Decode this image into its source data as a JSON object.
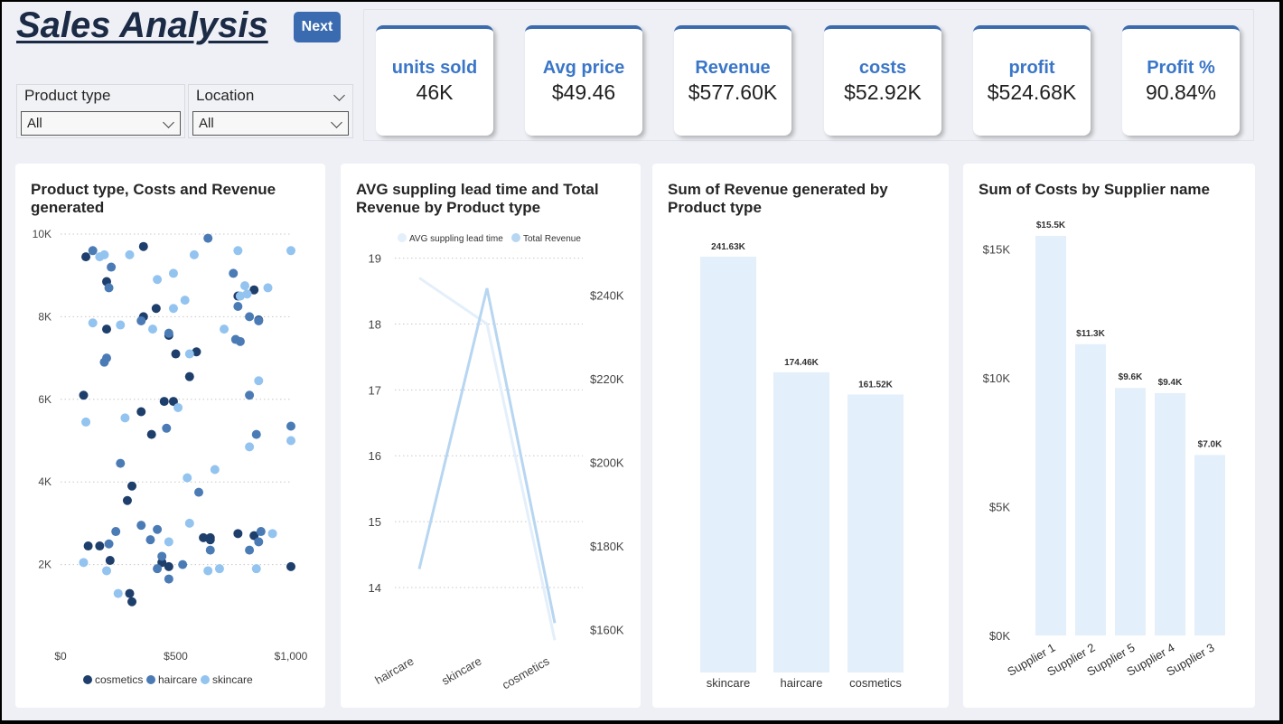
{
  "header": {
    "title": "Sales Analysis",
    "next_label": "Next"
  },
  "filters": [
    {
      "label": "Product type",
      "value": "All"
    },
    {
      "label": "Location",
      "value": "All"
    }
  ],
  "kpis": [
    {
      "label": "units sold",
      "value": "46K"
    },
    {
      "label": "Avg price",
      "value": "$49.46"
    },
    {
      "label": "Revenue",
      "value": "$577.60K"
    },
    {
      "label": "costs",
      "value": "$52.92K"
    },
    {
      "label": "profit",
      "value": "$524.68K"
    },
    {
      "label": "Profit %",
      "value": "90.84%"
    }
  ],
  "chart_data": [
    {
      "type": "scatter",
      "title": "Product type, Costs and Revenue generated",
      "xlim": [
        0,
        1000
      ],
      "ylim": [
        0,
        10000
      ],
      "x_ticks": [
        "$0",
        "$500",
        "$1,000"
      ],
      "y_ticks": [
        "2K",
        "4K",
        "6K",
        "8K",
        "10K"
      ],
      "legend_position": "bottom",
      "colors": {
        "cosmetics": "#1e3f6b",
        "haircare": "#4b7bb5",
        "skincare": "#93c3ef"
      },
      "series": [
        {
          "name": "cosmetics",
          "points": [
            [
              110,
              9450
            ],
            [
              360,
              9700
            ],
            [
              200,
              8850
            ],
            [
              360,
              8000
            ],
            [
              415,
              8200
            ],
            [
              200,
              7700
            ],
            [
              470,
              7550
            ],
            [
              500,
              7100
            ],
            [
              590,
              7150
            ],
            [
              560,
              6550
            ],
            [
              450,
              5950
            ],
            [
              490,
              5950
            ],
            [
              100,
              6100
            ],
            [
              395,
              5150
            ],
            [
              350,
              5700
            ],
            [
              310,
              3900
            ],
            [
              770,
              8500
            ],
            [
              840,
              8650
            ],
            [
              860,
              7920
            ],
            [
              120,
              2450
            ],
            [
              170,
              2450
            ],
            [
              215,
              2100
            ],
            [
              620,
              2650
            ],
            [
              650,
              2650
            ],
            [
              650,
              2600
            ],
            [
              770,
              2750
            ],
            [
              840,
              2700
            ],
            [
              1000,
              1950
            ],
            [
              300,
              1300
            ],
            [
              310,
              1100
            ],
            [
              440,
              2050
            ],
            [
              470,
              1950
            ],
            [
              290,
              3550
            ]
          ]
        },
        {
          "name": "haircare",
          "points": [
            [
              140,
              9600
            ],
            [
              210,
              8700
            ],
            [
              220,
              9200
            ],
            [
              190,
              6900
            ],
            [
              200,
              7000
            ],
            [
              350,
              7900
            ],
            [
              470,
              7600
            ],
            [
              460,
              5300
            ],
            [
              640,
              9900
            ],
            [
              750,
              9050
            ],
            [
              760,
              7450
            ],
            [
              780,
              7400
            ],
            [
              770,
              8250
            ],
            [
              820,
              8000
            ],
            [
              860,
              7900
            ],
            [
              820,
              6100
            ],
            [
              850,
              5150
            ],
            [
              1000,
              5350
            ],
            [
              350,
              2950
            ],
            [
              420,
              2850
            ],
            [
              390,
              2600
            ],
            [
              260,
              4450
            ],
            [
              420,
              1900
            ],
            [
              470,
              1650
            ],
            [
              440,
              2200
            ],
            [
              530,
              2000
            ],
            [
              600,
              3750
            ],
            [
              650,
              2350
            ],
            [
              820,
              2350
            ],
            [
              860,
              2550
            ],
            [
              870,
              2800
            ],
            [
              210,
              2500
            ],
            [
              240,
              2800
            ]
          ]
        },
        {
          "name": "skincare",
          "points": [
            [
              170,
              9450
            ],
            [
              190,
              9500
            ],
            [
              300,
              9500
            ],
            [
              420,
              8900
            ],
            [
              490,
              9050
            ],
            [
              580,
              9500
            ],
            [
              770,
              9600
            ],
            [
              780,
              8500
            ],
            [
              800,
              8750
            ],
            [
              810,
              8550
            ],
            [
              900,
              8700
            ],
            [
              1000,
              9600
            ],
            [
              490,
              8200
            ],
            [
              540,
              8400
            ],
            [
              400,
              7700
            ],
            [
              140,
              7850
            ],
            [
              260,
              7800
            ],
            [
              510,
              5800
            ],
            [
              110,
              5450
            ],
            [
              280,
              5550
            ],
            [
              560,
              7100
            ],
            [
              710,
              7700
            ],
            [
              860,
              6450
            ],
            [
              820,
              4850
            ],
            [
              1000,
              5000
            ],
            [
              550,
              4100
            ],
            [
              670,
              4300
            ],
            [
              100,
              2050
            ],
            [
              200,
              1850
            ],
            [
              560,
              3000
            ],
            [
              690,
              1900
            ],
            [
              640,
              1850
            ],
            [
              850,
              1900
            ],
            [
              920,
              2750
            ],
            [
              470,
              2550
            ],
            [
              250,
              1300
            ]
          ]
        }
      ]
    },
    {
      "type": "line",
      "title": "AVG suppling lead time and Total Revenue by Product type",
      "categories": [
        "haircare",
        "skincare",
        "cosmetics"
      ],
      "legend_position": "top",
      "y_left_ticks": [
        "14",
        "15",
        "16",
        "17",
        "18",
        "19"
      ],
      "y_left_lim": [
        13.3,
        19.2
      ],
      "y_right_ticks": [
        "$160K",
        "$180K",
        "$200K",
        "$220K",
        "$240K"
      ],
      "y_right_lim": [
        159000,
        252000
      ],
      "series": [
        {
          "name": "AVG suppling lead time",
          "axis": "left",
          "values": [
            18.7,
            18.0,
            13.2
          ]
        },
        {
          "name": "Total Revenue",
          "axis": "right",
          "values": [
            174460,
            241630,
            161520
          ]
        }
      ],
      "colors": {
        "AVG suppling lead time": "#e3effa",
        "Total Revenue": "#b7d6f1"
      }
    },
    {
      "type": "bar",
      "title": "Sum of Revenue generated by Product type",
      "categories": [
        "skincare",
        "haircare",
        "cosmetics"
      ],
      "values": [
        241.63,
        174.46,
        161.52
      ],
      "labels": [
        "241.63K",
        "174.46K",
        "161.52K"
      ],
      "ylim": [
        0,
        241.63
      ],
      "color": "#e3effb"
    },
    {
      "type": "bar",
      "title": "Sum of Costs by Supplier name",
      "categories": [
        "Supplier 1",
        "Supplier 2",
        "Supplier 5",
        "Supplier 4",
        "Supplier 3"
      ],
      "values": [
        15.5,
        11.3,
        9.6,
        9.4,
        7.0
      ],
      "labels": [
        "$15.5K",
        "$11.3K",
        "$9.6K",
        "$9.4K",
        "$7.0K"
      ],
      "y_ticks": [
        "$0K",
        "$5K",
        "$10K",
        "$15K"
      ],
      "ylim": [
        0,
        15.5
      ],
      "color": "#e3effb"
    }
  ]
}
